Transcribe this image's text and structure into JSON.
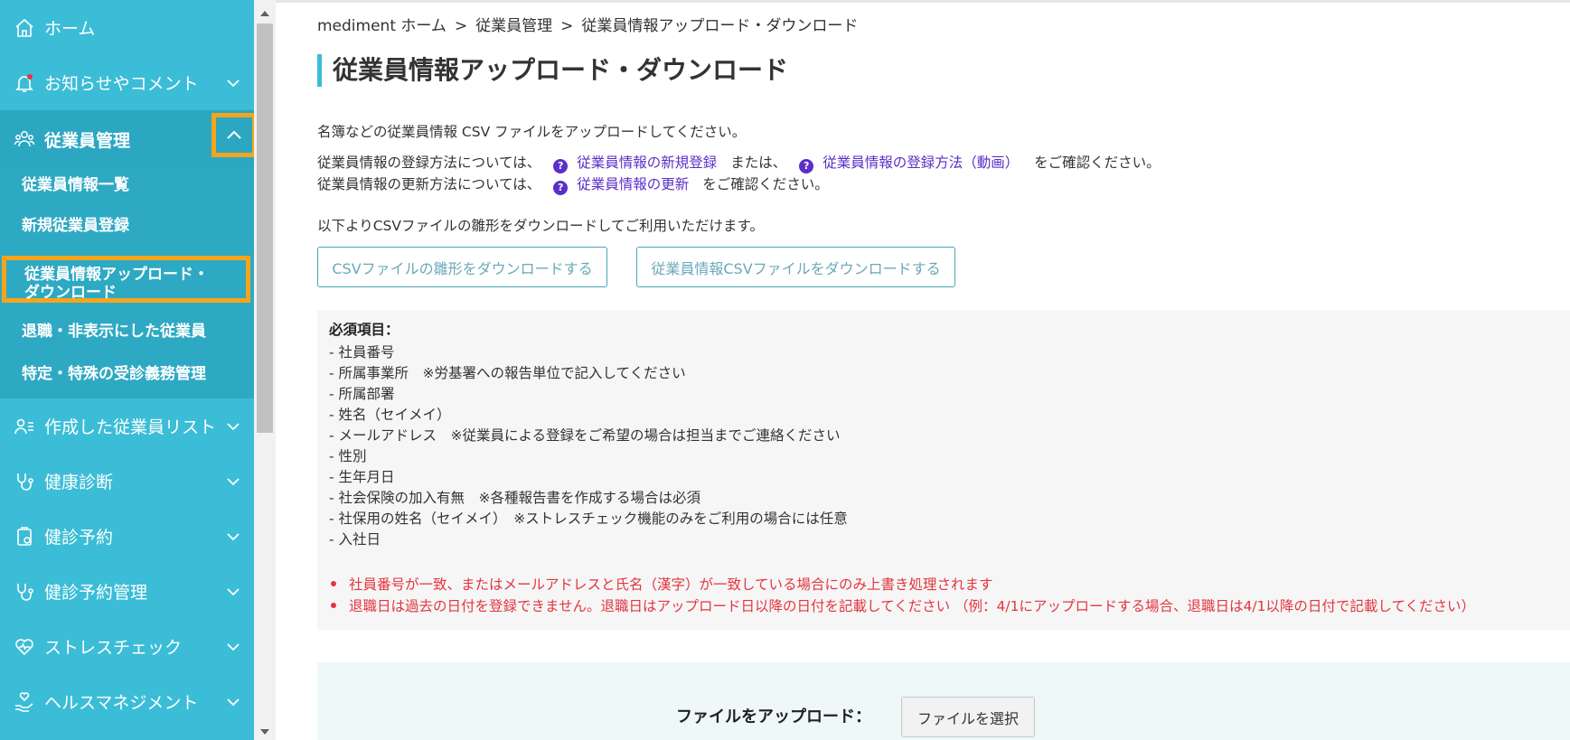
{
  "sidebar": {
    "home": "ホーム",
    "news": "お知らせやコメント",
    "employee_mgmt": "従業員管理",
    "subs": [
      "従業員情報一覧",
      "新規従業員登録",
      "従業員情報アップロード・ダウンロード",
      "退職・非表示にした従業員",
      "特定・特殊の受診義務管理"
    ],
    "selected_line1": "従業員情報アップロード・",
    "selected_line2": "ダウンロード",
    "employee_list": "作成した従業員リスト",
    "health_check": "健康診断",
    "booking": "健診予約",
    "booking_mgmt": "健診予約管理",
    "stress_check": "ストレスチェック",
    "health_mgmt": "ヘルスマネジメント"
  },
  "breadcrumb": {
    "home": "mediment ホーム",
    "mid": "従業員管理",
    "current": "従業員情報アップロード・ダウンロード",
    "sep": ">"
  },
  "page_title": "従業員情報アップロード・ダウンロード",
  "intro": {
    "line1": "名簿などの従業員情報 CSV ファイルをアップロードしてください。",
    "line2_prefix": "従業員情報の登録方法については、",
    "link_new": "従業員情報の新規登録",
    "or": "または、",
    "link_video": "従業員情報の登録方法（動画）",
    "line2_suffix": "をご確認ください。",
    "line3_prefix": "従業員情報の更新方法については、",
    "link_update": "従業員情報の更新",
    "line3_suffix": "をご確認ください。",
    "qmark": "?",
    "download_hint": "以下よりCSVファイルの雛形をダウンロードしてご利用いただけます。"
  },
  "buttons": {
    "download_template": "CSVファイルの雛形をダウンロードする",
    "download_employees": "従業員情報CSVファイルをダウンロードする",
    "choose_file": "ファイルを選択"
  },
  "required": {
    "title": "必須項目：",
    "items": [
      "- 社員番号",
      "- 所属事業所　※労基署への報告単位で記入してください",
      "- 所属部署",
      "- 姓名（セイメイ）",
      "- メールアドレス　※従業員による登録をご希望の場合は担当までご連絡ください",
      "- 性別",
      "- 生年月日",
      "- 社会保険の加入有無　※各種報告書を作成する場合は必須",
      "- 社保用の姓名（セイメイ）　※ストレスチェック機能のみをご利用の場合には任意",
      "- 入社日"
    ],
    "warnings": [
      "社員番号が一致、またはメールアドレスと氏名（漢字）が一致している場合にのみ上書き処理されます",
      "退職日は過去の日付を登録できません。退職日はアップロード日以降の日付を記載してください （例：4/1にアップロードする場合、退職日は4/1以降の日付で記載してください）"
    ]
  },
  "upload": {
    "label": "ファイルをアップロード："
  },
  "colors": {
    "sidebar": "#3cbdd7",
    "sidebar_sub": "#2ea9c3",
    "highlight": "#f6a41b",
    "link": "#5a2fc7",
    "warning": "#e2363f"
  }
}
